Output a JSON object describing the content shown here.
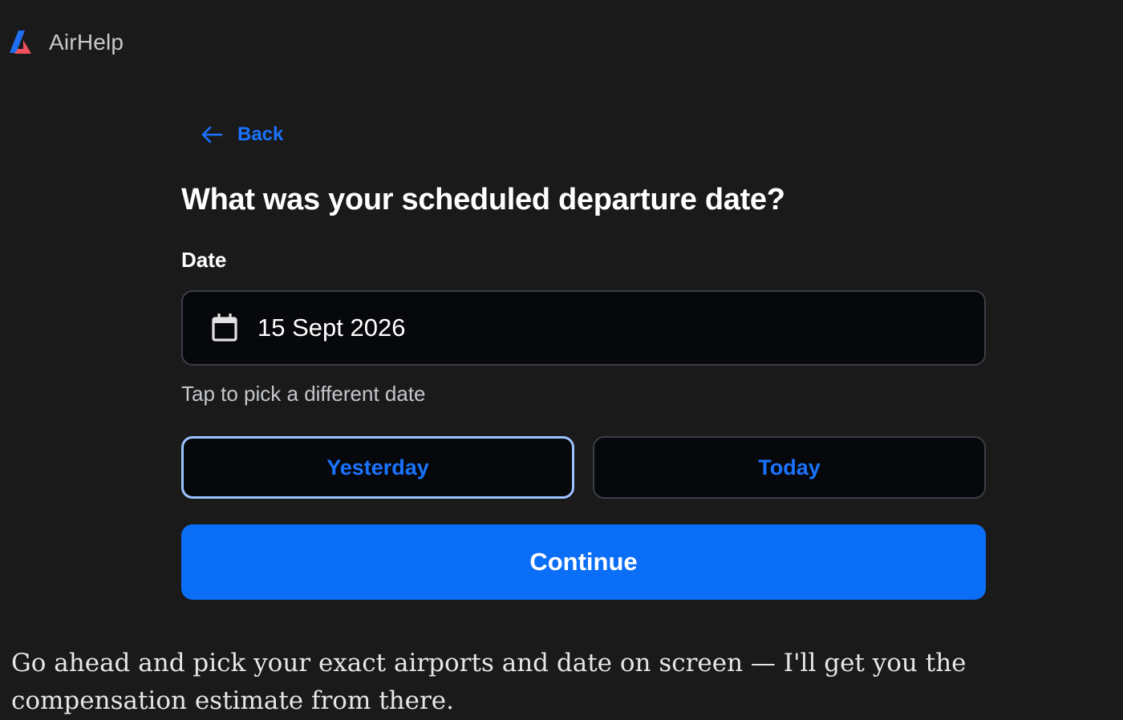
{
  "app": {
    "brand_name": "AirHelp",
    "logo_icon": "airhelp-logo-icon",
    "colors": {
      "background": "#1a1a1a",
      "accent": "#0a6ef7",
      "link": "#1a73ff",
      "selected_outline": "#9cc4ff",
      "logo_blue": "#1f6ff2",
      "logo_red": "#f0505a"
    }
  },
  "nav": {
    "back_label": "Back",
    "back_icon": "arrow-left-icon"
  },
  "form": {
    "title": "What was your scheduled departure date?",
    "date_label": "Date",
    "date_icon": "calendar-icon",
    "date_value": "15 Sept 2026",
    "hint": "Tap to pick a different date",
    "quick_options": [
      {
        "label": "Yesterday",
        "selected": true
      },
      {
        "label": "Today",
        "selected": false
      }
    ],
    "continue_label": "Continue"
  },
  "chat": {
    "message": "Go ahead and pick your exact airports and date on screen — I'll get you the compensation estimate from there."
  }
}
